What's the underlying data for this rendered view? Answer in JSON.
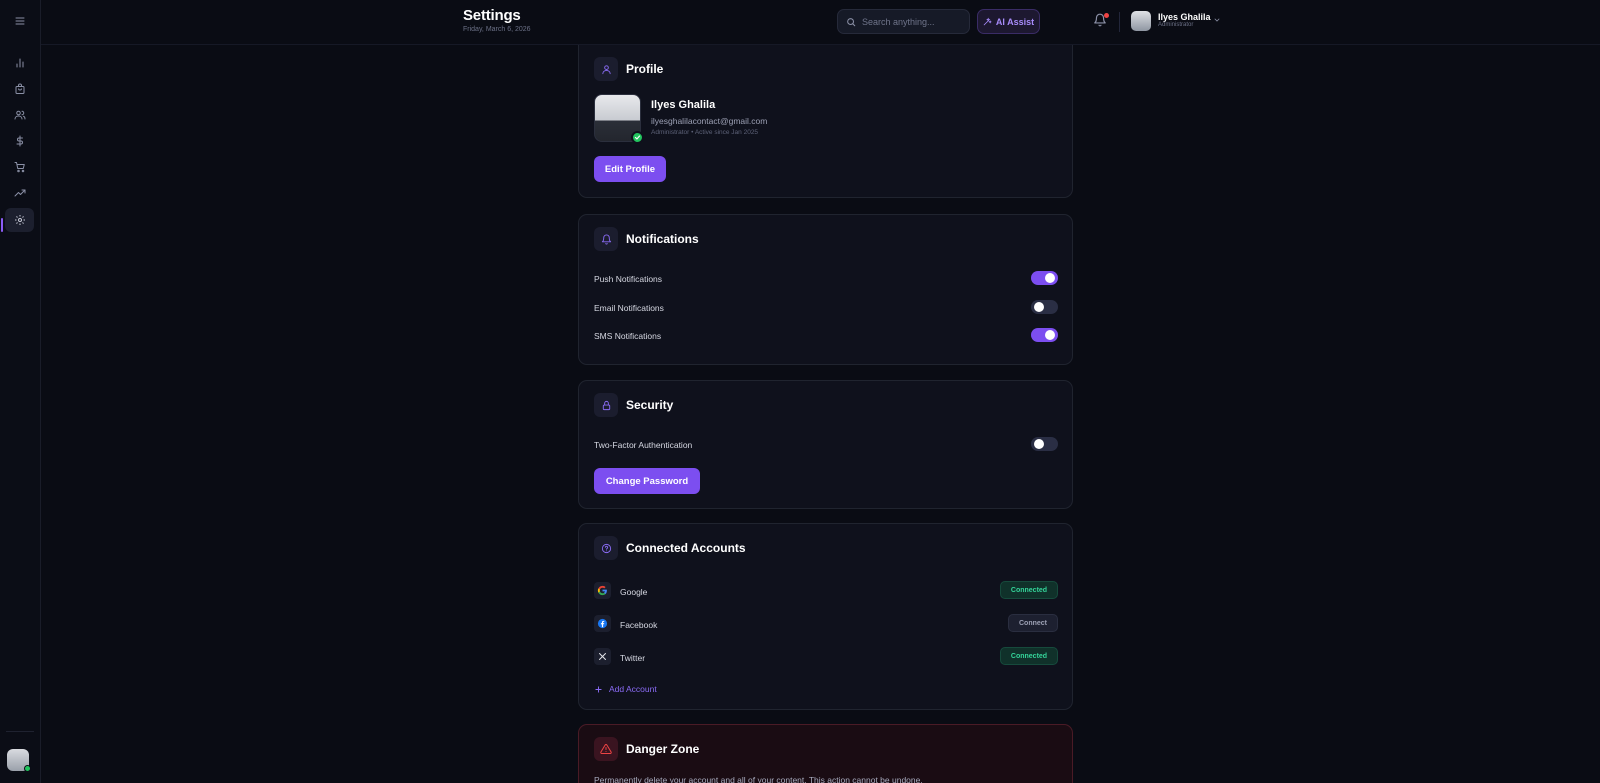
{
  "sidebar": {
    "items": [
      {
        "name": "menu",
        "icon": "hamburger-menu-icon"
      },
      {
        "name": "analytics",
        "icon": "bar-chart-icon"
      },
      {
        "name": "products",
        "icon": "shopping-bag-icon"
      },
      {
        "name": "customers",
        "icon": "users-icon"
      },
      {
        "name": "finance",
        "icon": "dollar-icon"
      },
      {
        "name": "orders",
        "icon": "cart-icon"
      },
      {
        "name": "growth",
        "icon": "trending-up-icon"
      },
      {
        "name": "settings",
        "icon": "gear-icon",
        "active": true
      }
    ]
  },
  "header": {
    "title": "Settings",
    "date": "Friday, March 6, 2026",
    "search_placeholder": "Search anything...",
    "ai_label": "AI Assist",
    "user_name": "Ilyes Ghalila",
    "user_role": "Administrator"
  },
  "profile": {
    "title": "Profile",
    "name": "Ilyes Ghalila",
    "email": "ilyesghalilacontact@gmail.com",
    "meta": "Administrator • Active since Jan 2025",
    "edit_label": "Edit Profile"
  },
  "notifications": {
    "title": "Notifications",
    "items": [
      {
        "label": "Push Notifications",
        "enabled": true
      },
      {
        "label": "Email Notifications",
        "enabled": false
      },
      {
        "label": "SMS Notifications",
        "enabled": true
      }
    ]
  },
  "security": {
    "title": "Security",
    "two_factor_label": "Two-Factor Authentication",
    "two_factor_enabled": false,
    "change_password_label": "Change Password"
  },
  "connected_accounts": {
    "title": "Connected Accounts",
    "accounts": [
      {
        "name": "Google",
        "status": "Connected"
      },
      {
        "name": "Facebook",
        "status": "Connect"
      },
      {
        "name": "Twitter",
        "status": "Connected"
      }
    ],
    "add_label": "Add Account"
  },
  "danger_zone": {
    "title": "Danger Zone",
    "description": "Permanently delete your account and all of your content. This action cannot be undone."
  },
  "colors": {
    "accent": "#7c4ef0",
    "success": "#34d399",
    "danger": "#ef4444",
    "background": "#0a0c14"
  }
}
